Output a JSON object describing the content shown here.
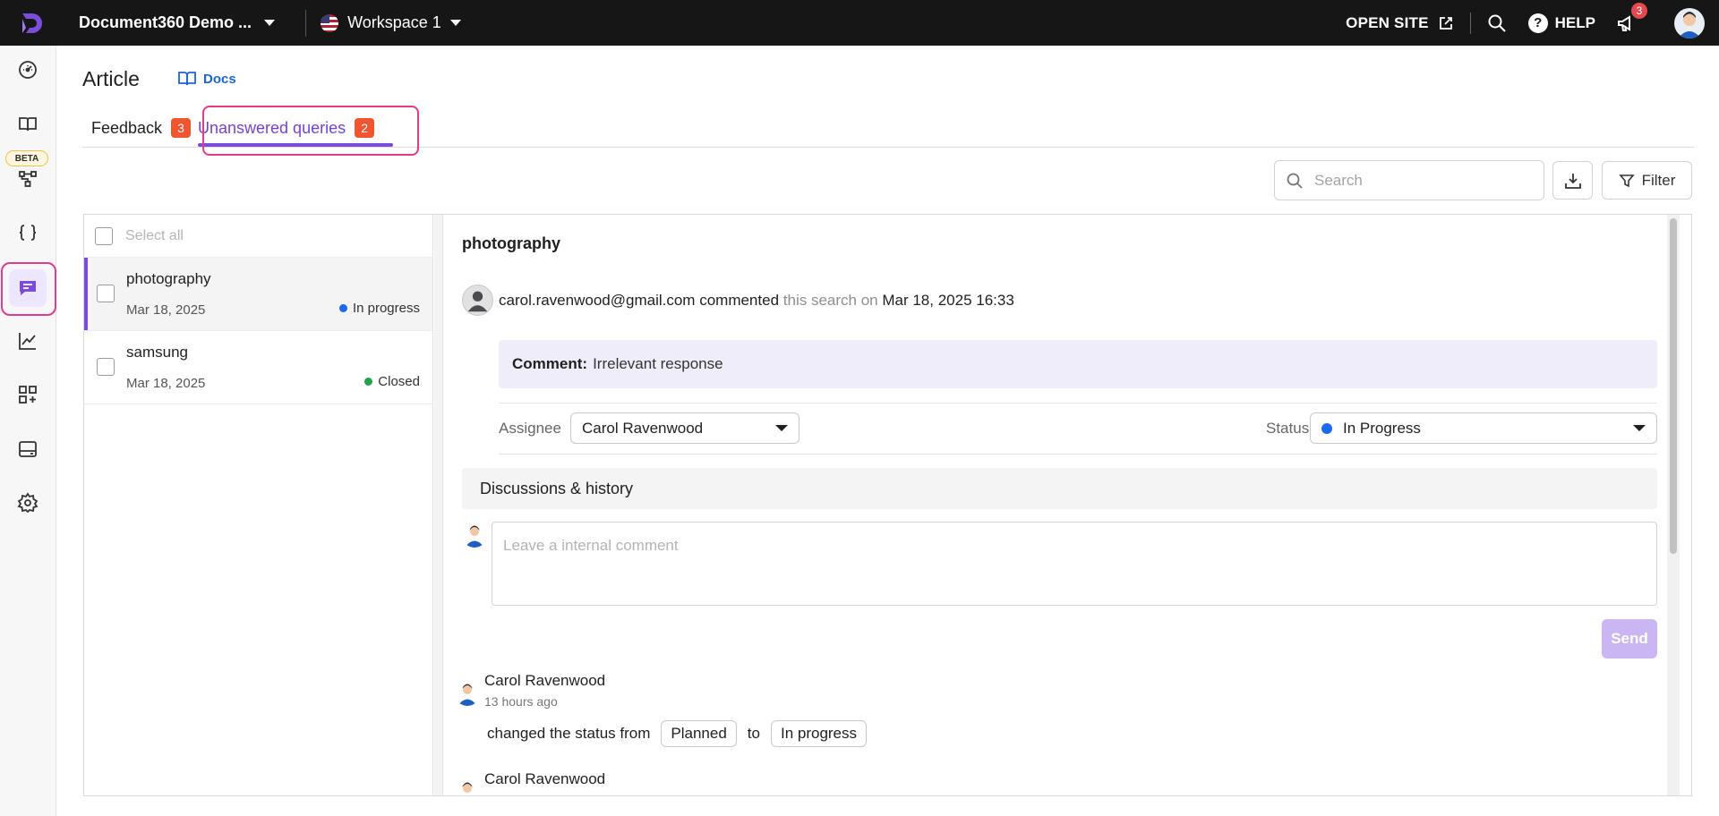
{
  "topbar": {
    "project_name": "Document360 Demo ...",
    "workspace": "Workspace 1",
    "open_site": "OPEN SITE",
    "help": "HELP",
    "notification_count": "3"
  },
  "sidebar": {
    "beta_label": "BETA",
    "items": [
      {
        "icon": "dashboard-icon"
      },
      {
        "icon": "book-icon"
      },
      {
        "icon": "workflow-icon"
      },
      {
        "icon": "api-braces-icon"
      },
      {
        "icon": "feedback-icon",
        "active": true
      },
      {
        "icon": "analytics-icon"
      },
      {
        "icon": "extensions-icon"
      },
      {
        "icon": "widget-icon"
      },
      {
        "icon": "settings-icon"
      }
    ]
  },
  "page": {
    "title": "Article",
    "docs_link": "Docs"
  },
  "tabs": [
    {
      "label": "Feedback",
      "count": "3"
    },
    {
      "label": "Unanswered queries",
      "count": "2",
      "active": true
    }
  ],
  "toolbar": {
    "search_placeholder": "Search",
    "filter_label": "Filter"
  },
  "list": {
    "select_all": "Select all",
    "items": [
      {
        "title": "photography",
        "date": "Mar 18, 2025",
        "status": "In progress",
        "status_color": "#1a6af0",
        "selected": true
      },
      {
        "title": "samsung",
        "date": "Mar 18, 2025",
        "status": "Closed",
        "status_color": "#22a34a"
      }
    ]
  },
  "detail": {
    "title": "photography",
    "commenter_email": "carol.ravenwood@gmail.com",
    "commented_word": "commented",
    "this_search_on": "this search on",
    "comment_datetime": "Mar 18, 2025 16:33",
    "comment_label": "Comment:",
    "comment_text": "Irrelevant response",
    "assignee_label": "Assignee",
    "assignee_value": "Carol Ravenwood",
    "status_label": "Status",
    "status_value": "In Progress",
    "status_color": "#1a6af0",
    "discussions_title": "Discussions & history",
    "comment_placeholder": "Leave a internal comment",
    "send_label": "Send",
    "history": [
      {
        "name": "Carol Ravenwood",
        "time": "13 hours ago",
        "action": "changed the status from",
        "from": "Planned",
        "to_word": "to",
        "to": "In progress"
      },
      {
        "name": "Carol Ravenwood"
      }
    ]
  },
  "colors": {
    "accent": "#7c4ddb",
    "highlight": "#e23c88",
    "badge": "#f0552f"
  }
}
